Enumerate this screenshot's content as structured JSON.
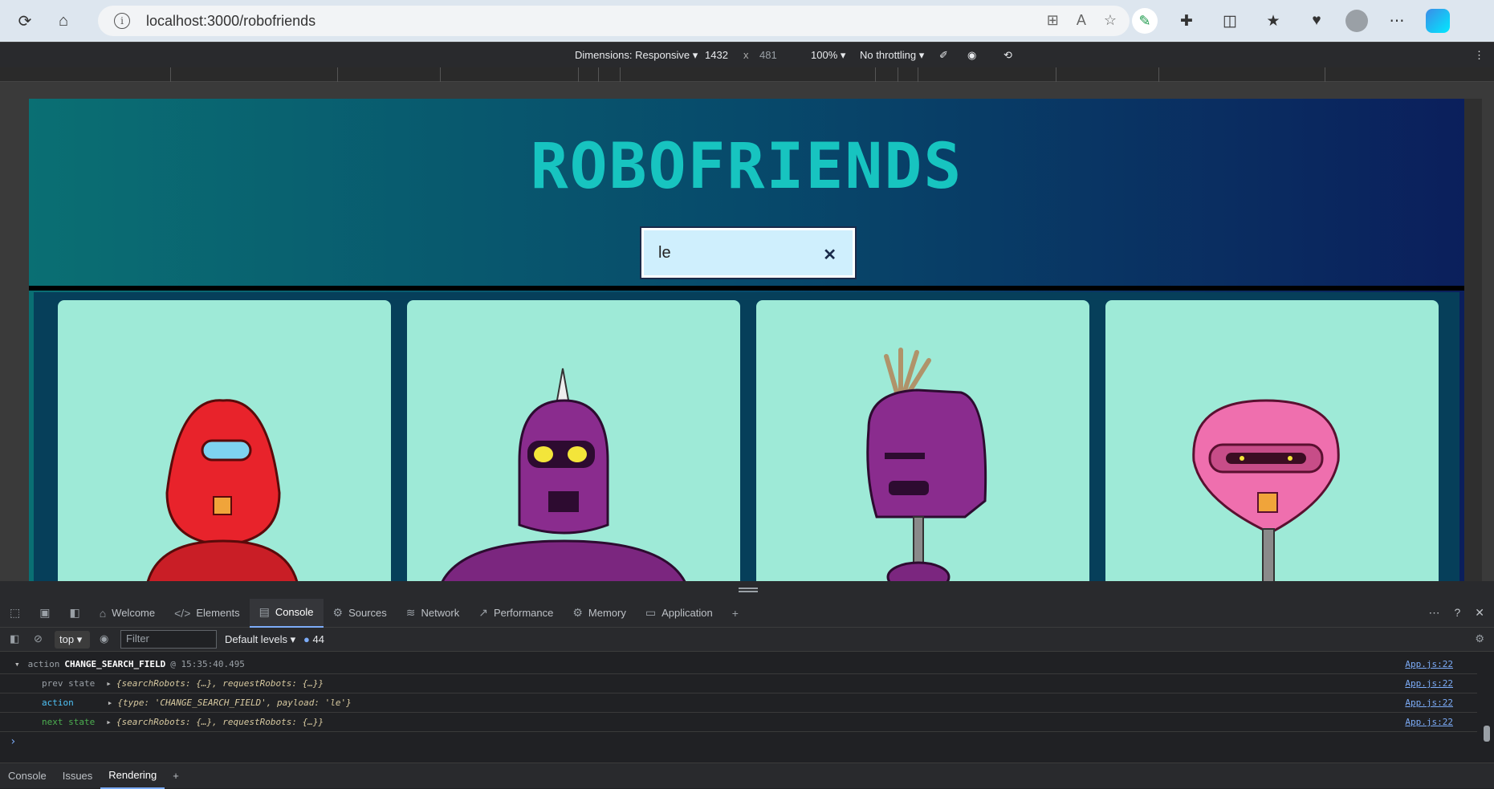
{
  "browser": {
    "url": "localhost:3000/robofriends",
    "icons": [
      "reload-icon",
      "home-icon",
      "info-icon",
      "apps-icon",
      "read-aloud-icon",
      "favorite-icon",
      "pen-icon",
      "extensions-icon",
      "split-icon",
      "favorites-icon",
      "health-icon",
      "profile-icon",
      "more-icon",
      "copilot-icon"
    ]
  },
  "device_toolbar": {
    "dimensions_label": "Dimensions: Responsive",
    "width": "1432",
    "times": "x",
    "height": "481",
    "zoom": "100%",
    "throttling": "No throttling"
  },
  "app": {
    "title": "ROBOFRIENDS",
    "search_value": "le",
    "clear_glyph": "✕",
    "colors": {
      "logo": "#17c4c0",
      "card": "#9eead7",
      "bg_start": "#0a6f73",
      "bg_end": "#0b1f5c"
    }
  },
  "devtools": {
    "tabs": [
      "Welcome",
      "Elements",
      "Console",
      "Sources",
      "Network",
      "Performance",
      "Memory",
      "Application"
    ],
    "active_tab": "Console",
    "context": "top",
    "filter_placeholder": "Filter",
    "levels": "Default levels",
    "message_count": "44",
    "log": {
      "action_label": "action",
      "action_name": "CHANGE_SEARCH_FIELD",
      "timestamp": "@ 15:35:40.495",
      "prev_state_label": "prev state",
      "prev_state_value": "{searchRobots: {…}, requestRobots: {…}}",
      "action_row_label": "action",
      "action_row_value": "{type: 'CHANGE_SEARCH_FIELD', payload: 'le'}",
      "next_state_label": "next state",
      "next_state_value": "{searchRobots: {…}, requestRobots: {…}}",
      "source": "App.js:22"
    },
    "bottom_tabs": [
      "Console",
      "Issues",
      "Rendering"
    ],
    "bottom_active": "Rendering"
  }
}
